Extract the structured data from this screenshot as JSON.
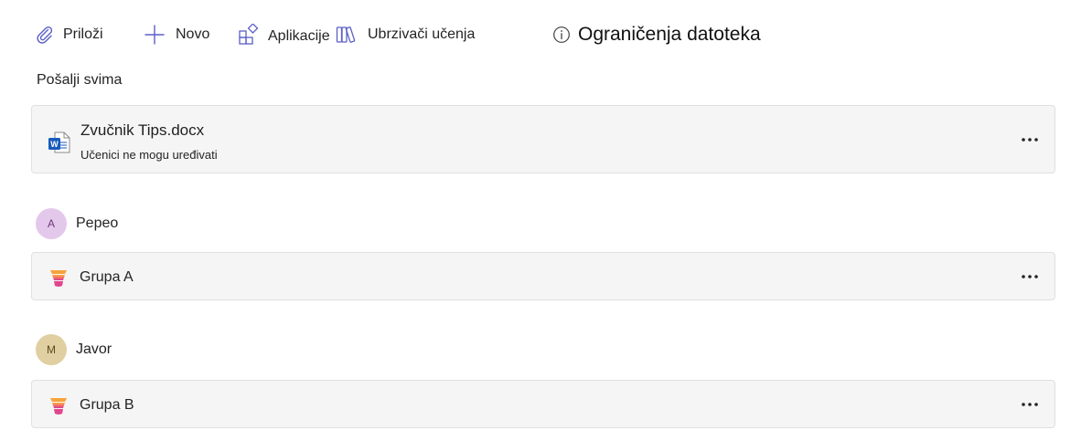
{
  "toolbar": {
    "attach_label": "Priloži",
    "new_label": "Novo",
    "apps_label": "Aplikacije",
    "accelerators_label": "Ubrzivači učenja",
    "limits_label": "Ograničenja datoteka"
  },
  "send_all": {
    "label": "Pošalji svima"
  },
  "file": {
    "name": "Zvučnik Tips.docx",
    "permission": "Učenici ne mogu uređivati",
    "icon": "word-document-icon"
  },
  "groups": [
    {
      "avatar_initial": "A",
      "person_name": "Pepeo",
      "avatar_color": "#e4c8ec",
      "group_name": "Grupa A"
    },
    {
      "avatar_initial": "M",
      "person_name": "Javor",
      "avatar_color": "#e0cfa1",
      "group_name": "Grupa B"
    }
  ],
  "colors": {
    "accent": "#5b5fc7",
    "card_bg": "#f5f5f5",
    "word_blue": "#185abd"
  }
}
